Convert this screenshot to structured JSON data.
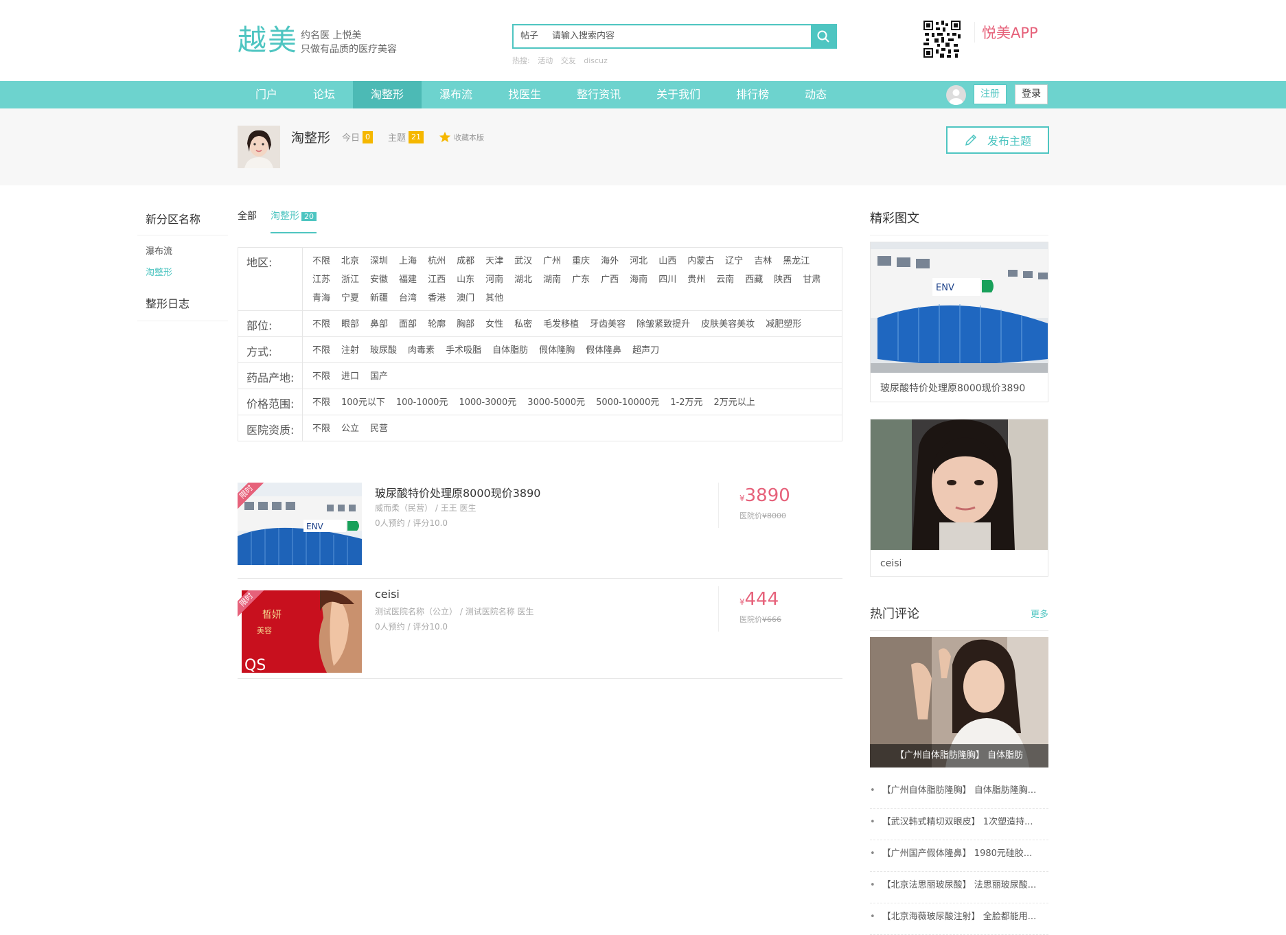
{
  "brand": {
    "logo_big": "越美",
    "tagline1": "约名医 上悦美",
    "tagline2": "只做有品质的医疗美容",
    "app_name": "悦美APP",
    "accent": "#4ec5c1",
    "price_color": "#e6617a"
  },
  "search": {
    "type": "帖子",
    "placeholder": "请输入搜索内容",
    "hot_label": "热搜:",
    "hot": [
      "活动",
      "交友",
      "discuz"
    ]
  },
  "nav": {
    "items": [
      "门户",
      "论坛",
      "淘整形",
      "瀑布流",
      "找医生",
      "整行资讯",
      "关于我们",
      "排行榜",
      "动态"
    ],
    "active": 2,
    "register": "注册",
    "login": "登录"
  },
  "forum": {
    "name": "淘整形",
    "today_label": "今日",
    "today": "0",
    "topics_label": "主题",
    "topics": "21",
    "fav": "收藏本版",
    "post_button": "发布主题"
  },
  "sidebar": {
    "heading": "新分区名称",
    "subs": [
      "瀑布流",
      "淘整形"
    ],
    "active_sub": 1,
    "heading2": "整形日志"
  },
  "tabs": {
    "all": "全部",
    "active": "淘整形",
    "count": "20"
  },
  "filters": [
    {
      "label": "地区:",
      "options": [
        "不限",
        "北京",
        "深圳",
        "上海",
        "杭州",
        "成都",
        "天津",
        "武汉",
        "广州",
        "重庆",
        "海外",
        "河北",
        "山西",
        "内蒙古",
        "辽宁",
        "吉林",
        "黑龙江",
        "江苏",
        "浙江",
        "安徽",
        "福建",
        "江西",
        "山东",
        "河南",
        "湖北",
        "湖南",
        "广东",
        "广西",
        "海南",
        "四川",
        "贵州",
        "云南",
        "西藏",
        "陕西",
        "甘肃",
        "青海",
        "宁夏",
        "新疆",
        "台湾",
        "香港",
        "澳门",
        "其他"
      ]
    },
    {
      "label": "部位:",
      "options": [
        "不限",
        "眼部",
        "鼻部",
        "面部",
        "轮廓",
        "胸部",
        "女性",
        "私密",
        "毛发移植",
        "牙齿美容",
        "除皱紧致提升",
        "皮肤美容美妆",
        "减肥塑形"
      ]
    },
    {
      "label": "方式:",
      "options": [
        "不限",
        "注射",
        "玻尿酸",
        "肉毒素",
        "手术吸脂",
        "自体脂肪",
        "假体隆胸",
        "假体隆鼻",
        "超声刀"
      ]
    },
    {
      "label": "药品产地:",
      "options": [
        "不限",
        "进口",
        "国产"
      ]
    },
    {
      "label": "价格范围:",
      "options": [
        "不限",
        "100元以下",
        "100-1000元",
        "1000-3000元",
        "3000-5000元",
        "5000-10000元",
        "1-2万元",
        "2万元以上"
      ]
    },
    {
      "label": "医院资质:",
      "options": [
        "不限",
        "公立",
        "民营"
      ]
    }
  ],
  "items": [
    {
      "tag": "限时",
      "title": "玻尿酸特价处理原8000现价3890",
      "hospital": "威而柔（民营）",
      "doctor": "王王 医生",
      "booked": "0人预约",
      "score": "评分10.0",
      "currency": "¥",
      "price": "3890",
      "orig_label": "医院价",
      "orig": "¥8000"
    },
    {
      "tag": "限时",
      "title": "ceisi",
      "hospital": "测试医院名称（公立）",
      "doctor": "测试医院名称 医生",
      "booked": "0人预约",
      "score": "评分10.0",
      "currency": "¥",
      "price": "444",
      "orig_label": "医院价",
      "orig": "¥666"
    }
  ],
  "right": {
    "featured_title": "精彩图文",
    "featured": [
      {
        "caption": "玻尿酸特价处理原8000现价3890"
      },
      {
        "caption": "ceisi"
      }
    ],
    "hot_title": "热门评论",
    "more": "更多",
    "hot_image_caption": "【广州自体脂肪隆胸】 自体脂肪",
    "hot_list": [
      "【广州自体脂肪隆胸】 自体脂肪隆胸...",
      "【武汉韩式精切双眼皮】 1次塑造持...",
      "【广州国产假体隆鼻】 1980元硅胶...",
      "【北京法思丽玻尿酸】 法思丽玻尿酸...",
      "【北京海薇玻尿酸注射】 全脸都能用..."
    ]
  }
}
